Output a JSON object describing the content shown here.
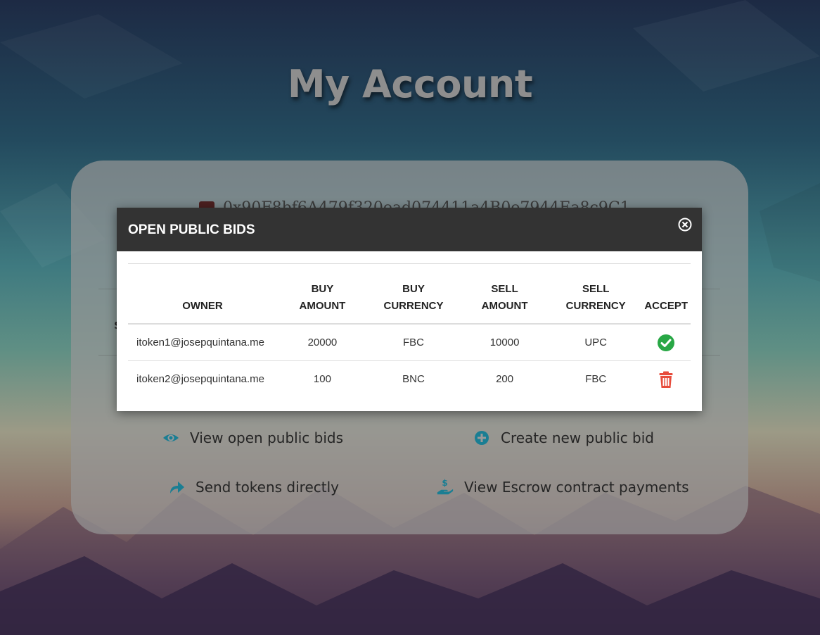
{
  "page": {
    "title": "My Account"
  },
  "card": {
    "wallet_address": "0x90F8bf6A479f320ead074411a4B0e7944Ea8c9C1",
    "actions": [
      {
        "label": "View open public bids",
        "icon": "eye-icon"
      },
      {
        "label": "Create new public bid",
        "icon": "plus-circle-icon"
      },
      {
        "label": "Send tokens directly",
        "icon": "share-arrow-icon"
      },
      {
        "label": "View Escrow contract payments",
        "icon": "hand-dollar-icon"
      }
    ]
  },
  "modal": {
    "title": "OPEN PUBLIC BIDS",
    "columns": {
      "owner": "OWNER",
      "buy_amount_1": "BUY",
      "buy_amount_2": "AMOUNT",
      "buy_currency_1": "BUY",
      "buy_currency_2": "CURRENCY",
      "sell_amount_1": "SELL",
      "sell_amount_2": "AMOUNT",
      "sell_currency_1": "SELL",
      "sell_currency_2": "CURRENCY",
      "accept": "ACCEPT"
    },
    "rows": [
      {
        "owner": "itoken1@josepquintana.me",
        "buy_amount": "20000",
        "buy_currency": "FBC",
        "sell_amount": "10000",
        "sell_currency": "UPC",
        "action_icon": "check-circle-icon"
      },
      {
        "owner": "itoken2@josepquintana.me",
        "buy_amount": "100",
        "buy_currency": "BNC",
        "sell_amount": "200",
        "sell_currency": "FBC",
        "action_icon": "trash-icon"
      }
    ]
  },
  "colors": {
    "accent": "#1a7e93",
    "accept": "#28a745",
    "delete": "#e74c3c",
    "header_bg": "#333333"
  }
}
